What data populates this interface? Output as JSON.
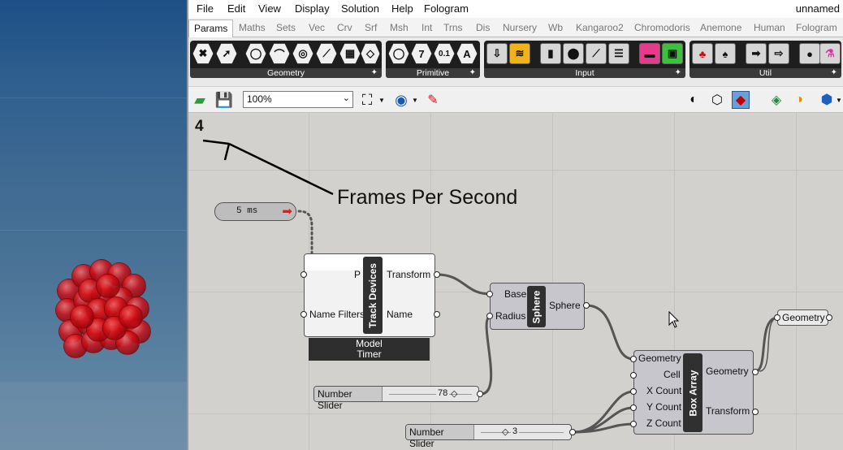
{
  "menu": {
    "items": [
      "File",
      "Edit",
      "View",
      "Display",
      "Solution",
      "Help",
      "Fologram"
    ],
    "window_title": "unnamed"
  },
  "tabs": [
    "Params",
    "Maths",
    "Sets",
    "Vec",
    "Crv",
    "Srf",
    "Msh",
    "Int",
    "Trns",
    "Dis",
    "Nursery",
    "Wb",
    "Kangaroo2",
    "Chromodoris",
    "Anemone",
    "Human",
    "Fologram"
  ],
  "ribbon": {
    "panels": [
      "Geometry",
      "Primitive",
      "Input",
      "Util"
    ],
    "primitive_icons": [
      "7",
      "0.1",
      "A"
    ]
  },
  "toolbar": {
    "zoom": "100%"
  },
  "canvas": {
    "fps_readout": "4",
    "annotation": "Frames Per Second",
    "timer": {
      "value": "5 ms"
    },
    "track_devices": {
      "title": "Track Devices",
      "inputs": [
        "P",
        "Name Filters"
      ],
      "outputs": [
        "Transform",
        "Name"
      ],
      "footer_line1": "Model",
      "footer_line2": "Timer"
    },
    "sphere": {
      "title": "Sphere",
      "inputs": [
        "Base",
        "Radius"
      ],
      "outputs": [
        "Sphere"
      ]
    },
    "box_array": {
      "title": "Box Array",
      "inputs": [
        "Geometry",
        "Cell",
        "X Count",
        "Y Count",
        "Z Count"
      ],
      "outputs": [
        "Geometry",
        "Transform"
      ]
    },
    "geometry_param": {
      "label": "Geometry"
    },
    "slider1": {
      "name": "Number Slider",
      "value": "78"
    },
    "slider2": {
      "name": "Number Slider",
      "value": "3"
    }
  },
  "colors": {
    "viewport_bg": "#2f5f8f",
    "sphere_red": "#d10d14",
    "canvas_bg": "#d3d1cd",
    "component_dark": "#303030"
  }
}
